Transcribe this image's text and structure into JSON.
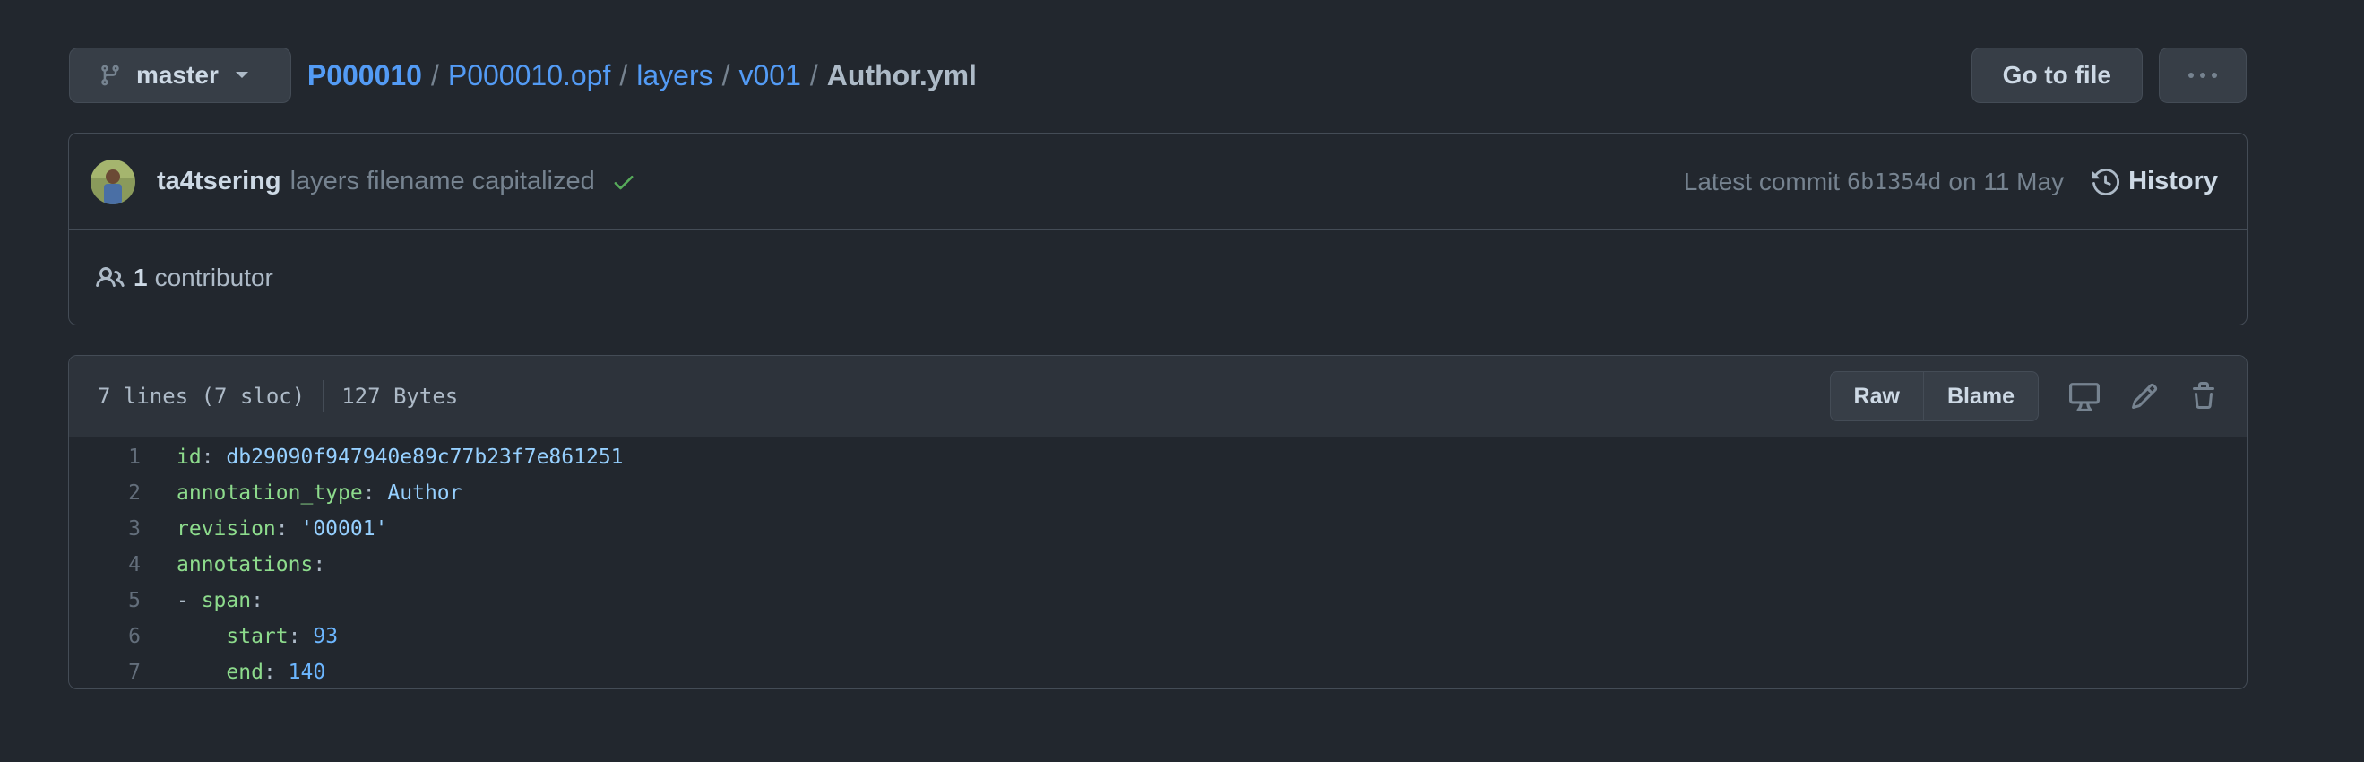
{
  "branch": {
    "name": "master"
  },
  "breadcrumb": {
    "repo": "P000010",
    "parts": [
      "P000010.opf",
      "layers",
      "v001"
    ],
    "file": "Author.yml",
    "sep": "/"
  },
  "actions": {
    "go_to_file": "Go to file",
    "more_icon": "kebab-horizontal-icon"
  },
  "commit": {
    "author": "ta4tsering",
    "message": "layers filename capitalized",
    "latest_label": "Latest commit",
    "sha": "6b1354d",
    "date": "on 11 May",
    "history_label": "History"
  },
  "contributors": {
    "count": "1",
    "label": "contributor"
  },
  "file": {
    "lines_info": "7 lines (7 sloc)",
    "size": "127 Bytes",
    "raw_label": "Raw",
    "blame_label": "Blame"
  },
  "code": [
    {
      "n": "1",
      "indent": "",
      "key": "id",
      "sep": ": ",
      "value": "db29090f947940e89c77b23f7e861251",
      "vtype": "val"
    },
    {
      "n": "2",
      "indent": "",
      "key": "annotation_type",
      "sep": ": ",
      "value": "Author",
      "vtype": "val"
    },
    {
      "n": "3",
      "indent": "",
      "key": "revision",
      "sep": ": ",
      "value": "'00001'",
      "vtype": "val"
    },
    {
      "n": "4",
      "indent": "",
      "key": "annotations",
      "sep": ":",
      "value": "",
      "vtype": "val"
    },
    {
      "n": "5",
      "indent": "- ",
      "key": "span",
      "sep": ":",
      "value": "",
      "vtype": "val"
    },
    {
      "n": "6",
      "indent": "    ",
      "key": "start",
      "sep": ": ",
      "value": "93",
      "vtype": "num"
    },
    {
      "n": "7",
      "indent": "    ",
      "key": "end",
      "sep": ": ",
      "value": "140",
      "vtype": "num"
    }
  ],
  "colors": {
    "link": "#539bf5",
    "success": "#57ab5a",
    "key": "#8ddb8c",
    "string": "#96d0ff"
  }
}
